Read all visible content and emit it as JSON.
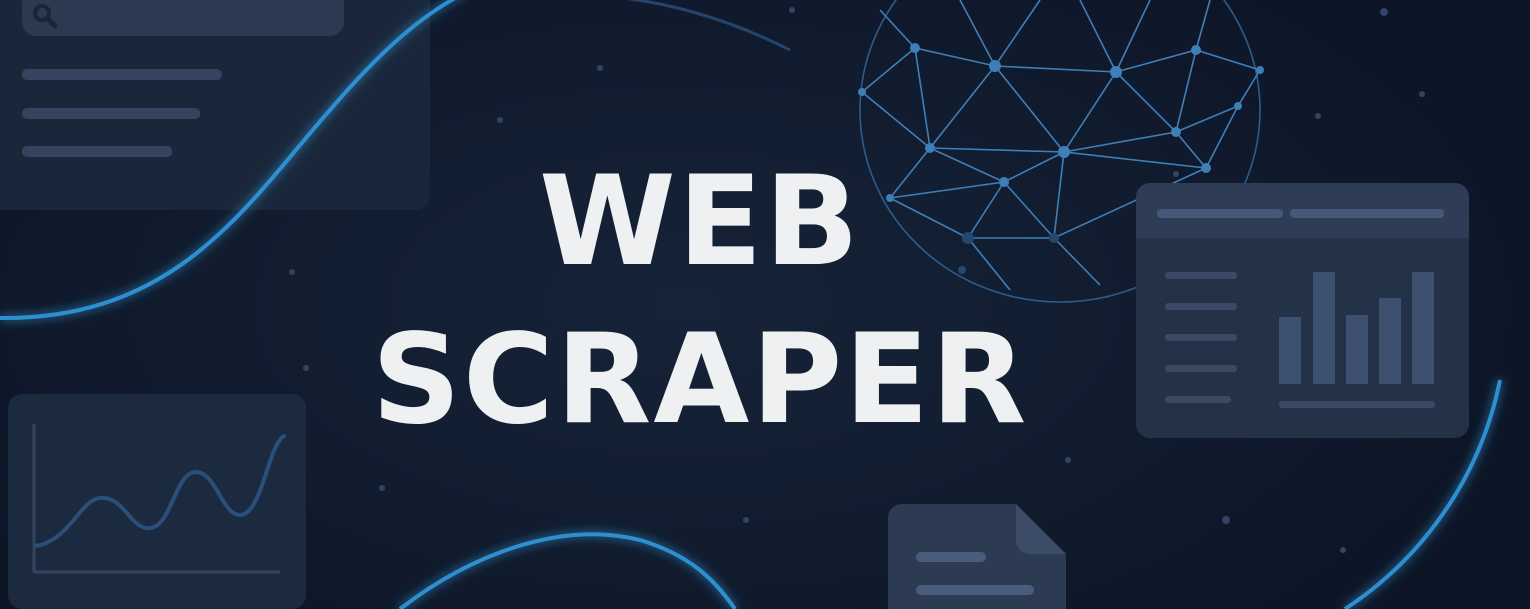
{
  "headline": {
    "line1": "WEB",
    "line2": "SCRAPER"
  },
  "colors": {
    "background": "#0f1a2c",
    "panel": "#1c2a40",
    "panel_line": "#34445e",
    "accent_blue": "#2e8fd0",
    "globe_line": "#3f7fb8",
    "title_text": "#eef0f2"
  },
  "icons": {
    "search": "search-icon",
    "globe": "globe-network-icon",
    "document": "document-icon",
    "bar_chart": "bar-chart-icon",
    "line_chart": "line-chart-icon"
  }
}
